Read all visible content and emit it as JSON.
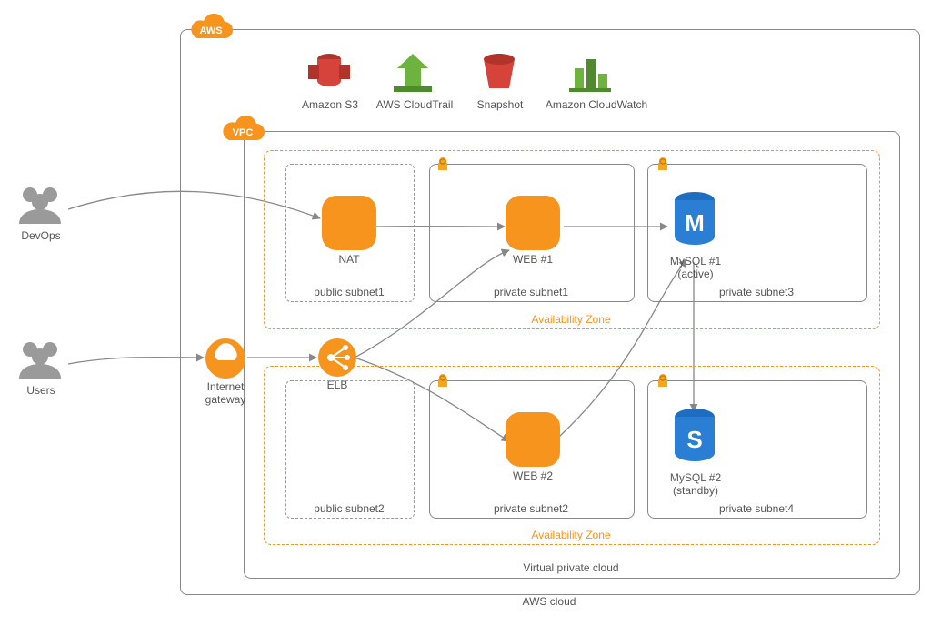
{
  "title": "AWS cloud architecture diagram",
  "badges": {
    "aws": "AWS",
    "vpc": "VPC"
  },
  "externals": {
    "devops": "DevOps",
    "users": "Users",
    "igw_line1": "Internet",
    "igw_line2": "gateway",
    "elb": "ELB"
  },
  "global_services": {
    "s3": "Amazon S3",
    "cloudtrail": "AWS CloudTrail",
    "snapshot": "Snapshot",
    "cloudwatch": "Amazon CloudWatch"
  },
  "containers": {
    "aws_cloud": "AWS cloud",
    "vpc": "Virtual private cloud",
    "az1": "Availability Zone",
    "az2": "Availability Zone",
    "public_subnet1": "public subnet1",
    "public_subnet2": "public subnet2",
    "private_subnet1": "private subnet1",
    "private_subnet2": "private subnet2",
    "private_subnet3": "private subnet3",
    "private_subnet4": "private subnet4"
  },
  "resources": {
    "nat": "NAT",
    "web1": "WEB #1",
    "web2": "WEB #2",
    "mysql1_name": "MySQL #1",
    "mysql1_role": "(active)",
    "mysql2_name": "MySQL #2",
    "mysql2_role": "(standby)"
  },
  "colors": {
    "aws_orange": "#f7941e",
    "green": "#6eb33f",
    "red": "#d6433a",
    "blue": "#1e6dc0",
    "gray": "#777777"
  },
  "edges": [
    {
      "from": "devops",
      "to": "nat"
    },
    {
      "from": "users",
      "to": "internet-gateway"
    },
    {
      "from": "internet-gateway",
      "to": "elb"
    },
    {
      "from": "elb",
      "to": "web1"
    },
    {
      "from": "elb",
      "to": "web2"
    },
    {
      "from": "nat",
      "to": "web1"
    },
    {
      "from": "web1",
      "to": "mysql1"
    },
    {
      "from": "web2",
      "to": "mysql1"
    },
    {
      "from": "mysql1",
      "to": "mysql2"
    }
  ]
}
